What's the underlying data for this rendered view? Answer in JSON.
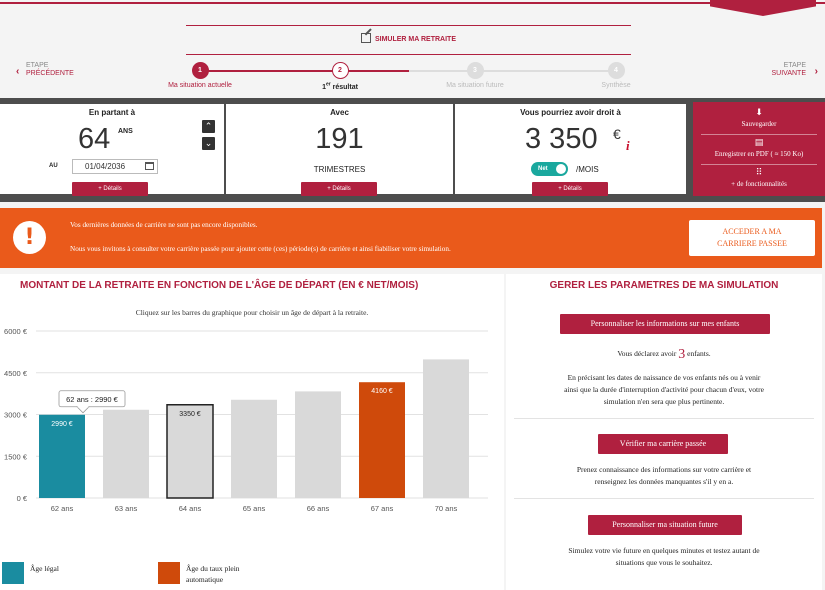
{
  "header": {
    "simulate_label": "SIMULER MA RETRAITE"
  },
  "steps": {
    "prev_line1": "ETAPE",
    "prev_line2": "PRÉCÉDENTE",
    "next_line1": "ETAPE",
    "next_line2": "SUIVANTE",
    "items": [
      {
        "num": "1",
        "label": "Ma situation actuelle"
      },
      {
        "num": "2",
        "label": "1er résultat",
        "label_sup": "er"
      },
      {
        "num": "3",
        "label": "Ma situation future"
      },
      {
        "num": "4",
        "label": "Synthèse"
      }
    ]
  },
  "summary": {
    "age_title": "En partant à",
    "age_value": "64",
    "age_unit": "ANS",
    "date_label": "AU",
    "date_value": "01/04/2036",
    "trim_title": "Avec",
    "trim_value": "191",
    "trim_unit": "TRIMESTRES",
    "amount_title": "Vous pourriez avoir droit à",
    "amount_value": "3 350",
    "amount_currency": "€",
    "info_mark": "i",
    "toggle_label": "Net",
    "per_month": "/MOIS",
    "details_label": "+ Détails"
  },
  "side_panel": {
    "save_label": "Sauvegarder",
    "pdf_label": "Enregistrer en PDF ( ≈ 150 Ko)",
    "more_label": "+ de fonctionnalités"
  },
  "alert": {
    "line1": "Vos dernières données de carrière ne sont pas encore disponibles.",
    "line2": "Nous vous invitons à consulter votre carrière passée pour ajouter cette (ces) période(s) de carrière et ainsi fiabiliser votre simulation.",
    "button_line1": "ACCEDER A MA",
    "button_line2": "CARRIERE PASSEE"
  },
  "chart_panel": {
    "title": "MONTANT DE LA RETRAITE EN FONCTION DE L'ÂGE DE DÉPART (EN € NET/MOIS)",
    "subtitle": "Cliquez sur les barres du graphique pour choisir un âge de départ à la retraite.",
    "tooltip": "62 ans : 2990 €",
    "legend_legal": "Âge légal",
    "legend_full_line1": "Âge du taux plein",
    "legend_full_line2": "automatique"
  },
  "chart_data": {
    "type": "bar",
    "categories": [
      "62 ans",
      "63 ans",
      "64 ans",
      "65 ans",
      "66 ans",
      "67 ans",
      "70 ans"
    ],
    "values": [
      2990,
      3170,
      3350,
      3530,
      3830,
      4160,
      4980
    ],
    "value_labels": [
      "2990 €",
      "",
      "3350 €",
      "",
      "",
      "4160 €",
      ""
    ],
    "yticks": [
      0,
      1500,
      3000,
      4500,
      6000
    ],
    "ytick_labels": [
      "0 €",
      "1500 €",
      "3000 €",
      "4500 €",
      "6000 €"
    ],
    "ylim": [
      0,
      6000
    ],
    "grid": true,
    "legal_index": 0,
    "selected_index": 2,
    "full_rate_index": 5,
    "colors": {
      "legal": "#1a8ca0",
      "full_rate": "#cf4a0b",
      "default": "#d9d9d9",
      "selected_border": "#222222"
    }
  },
  "params_panel": {
    "title": "GERER LES PARAMETRES DE MA SIMULATION",
    "btn_children": "Personnaliser les informations sur mes enfants",
    "children_pre": "Vous déclarez avoir",
    "children_count": "3",
    "children_post": "enfants.",
    "children_desc_1": "En précisant les dates de naissance de vos enfants nés ou à venir",
    "children_desc_2": "ainsi que la durée d'interruption d'activité pour chacun d'eux, votre",
    "children_desc_3": "simulation n'en sera que plus pertinente.",
    "btn_career": "Vérifier ma carrière passée",
    "career_desc_1": "Prenez connaissance des informations sur votre carrière et",
    "career_desc_2": "renseignez les données manquantes s'il y en a.",
    "btn_future": "Personnaliser ma situation future",
    "future_desc_1": "Simulez votre vie future en quelques minutes et testez autant de",
    "future_desc_2": "situations que vous le souhaitez."
  },
  "colors": {
    "brand": "#b0203f",
    "alert": "#ea5a1b",
    "toggle": "#1aa89e"
  }
}
